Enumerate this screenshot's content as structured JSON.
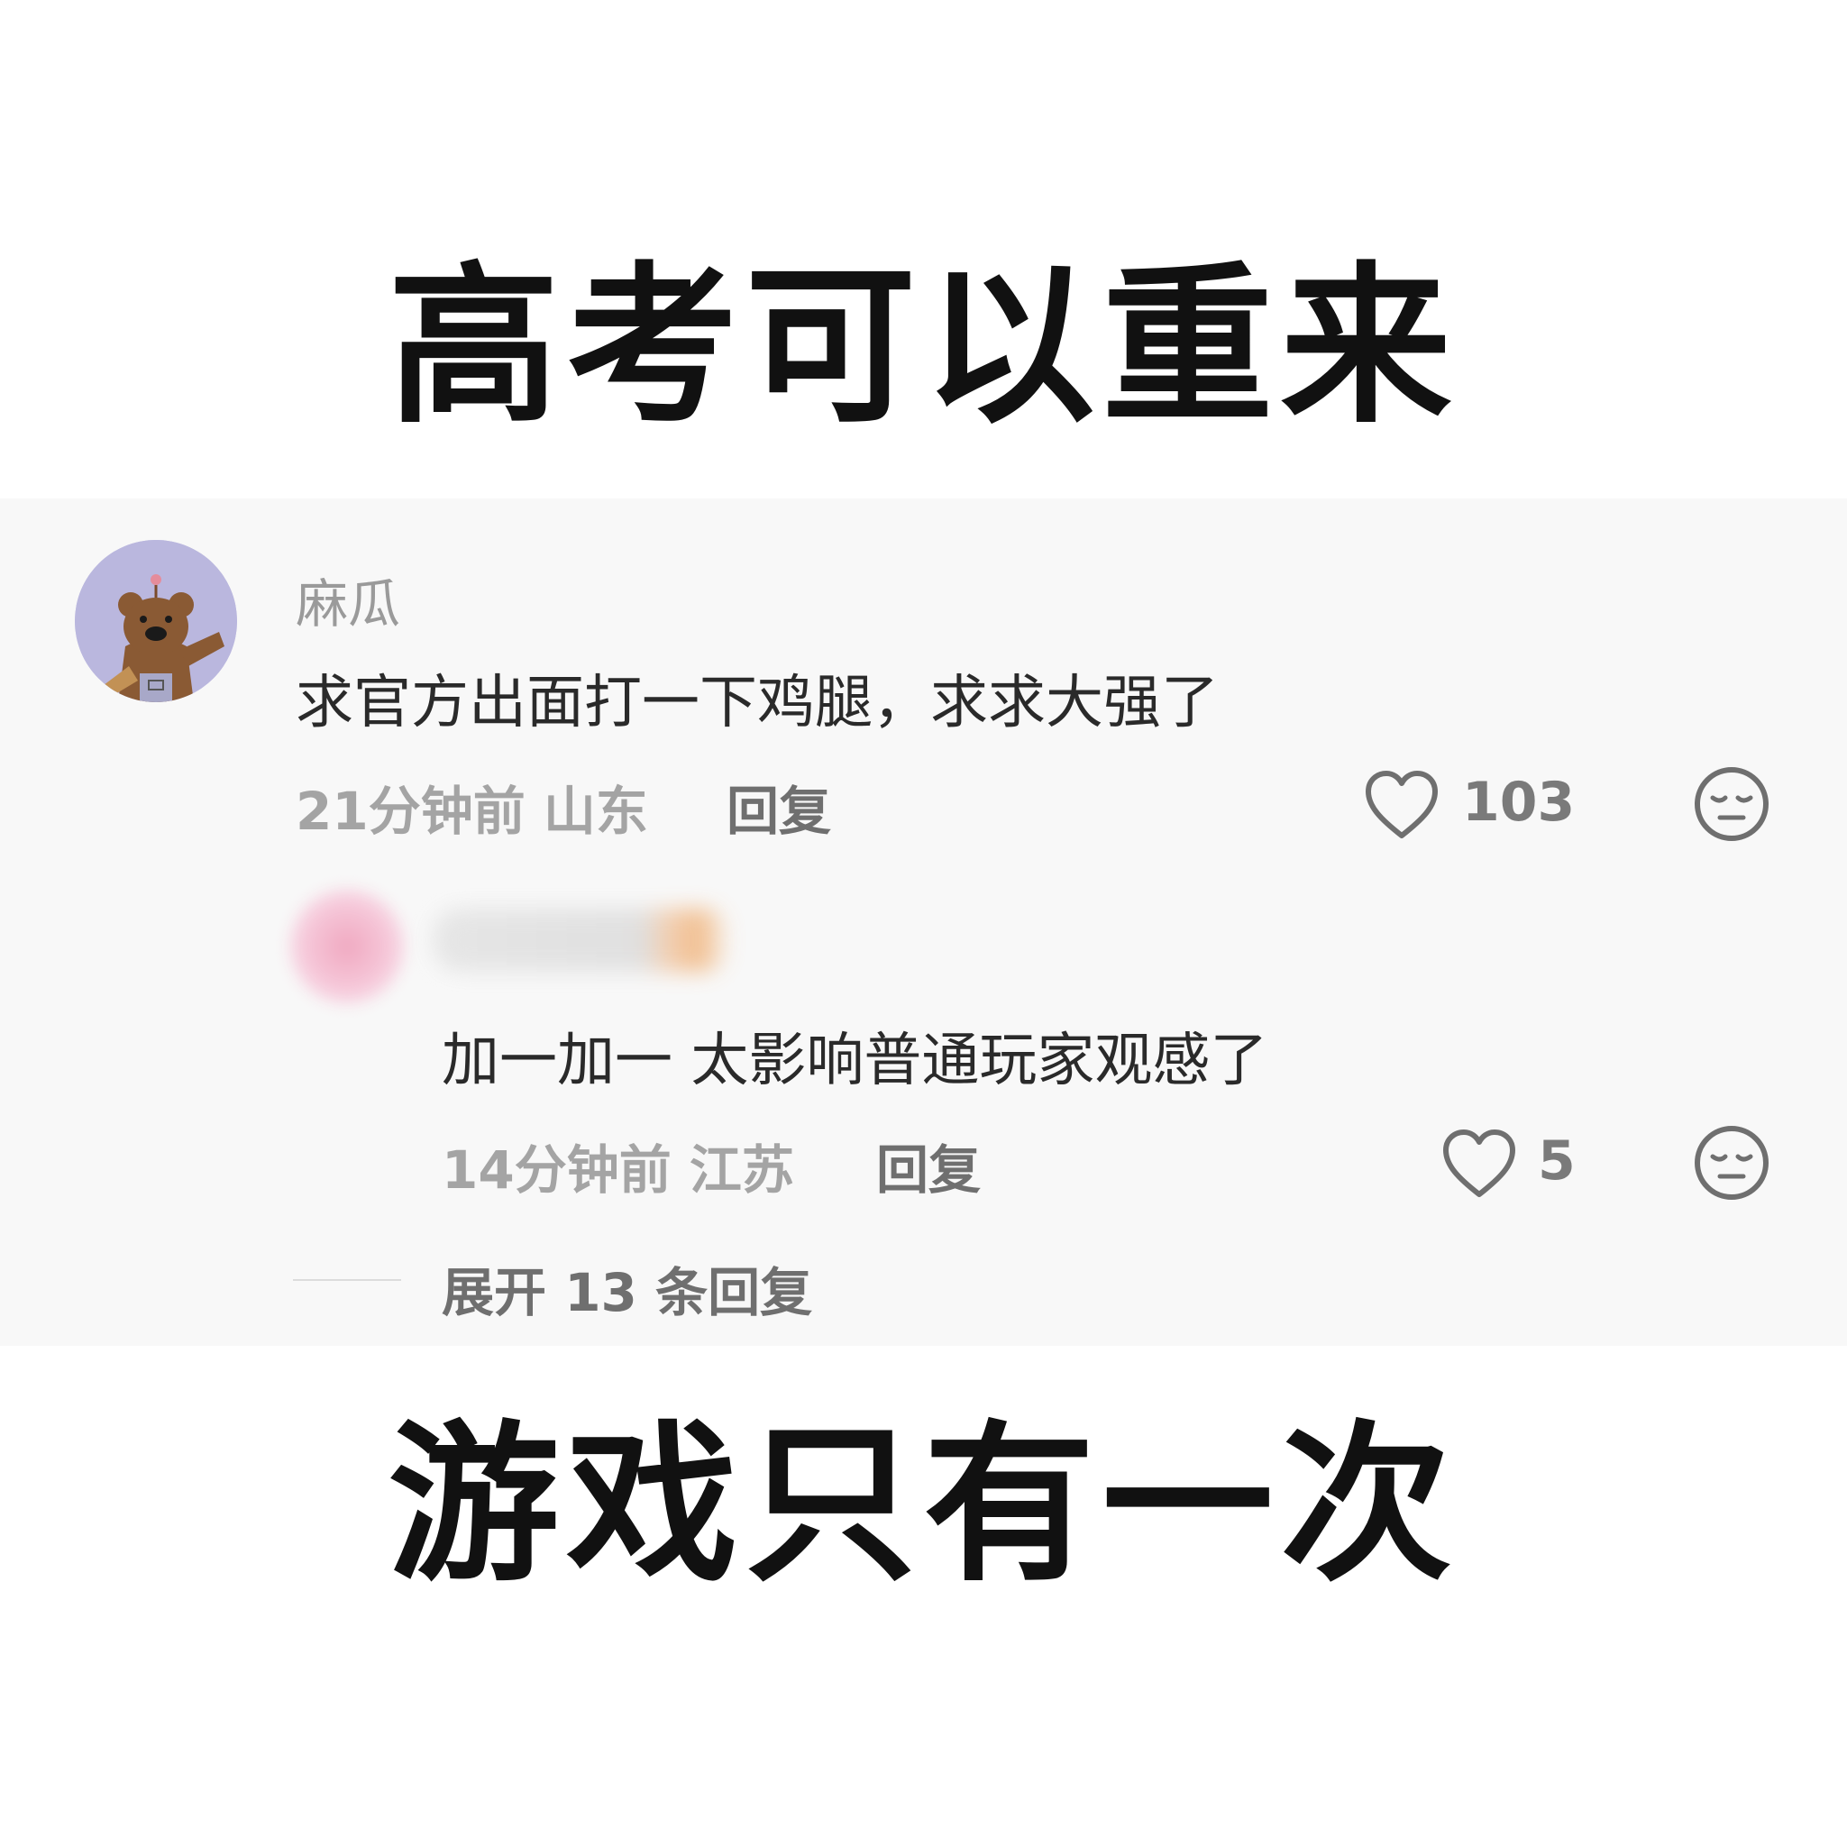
{
  "caption_top": "高考可以重来",
  "caption_bottom": "游戏只有一次",
  "comment": {
    "username": "麻瓜",
    "text": "求官方出面打一下鸡腿，求求大强了",
    "meta": "21分钟前 山东",
    "reply_label": "回复",
    "likes": "103",
    "avatar_icon": "bear-avatar-icon"
  },
  "reply": {
    "text": "加一加一 太影响普通玩家观感了",
    "meta": "14分钟前 江苏",
    "reply_label": "回复",
    "likes": "5"
  },
  "expand_replies": "展开 13 条回复",
  "colors": {
    "panel_bg": "#f8f8f8",
    "avatar_bg": "#bab7de",
    "meta_text": "#a4a4a4",
    "icon_stroke": "#6f6f6f"
  }
}
